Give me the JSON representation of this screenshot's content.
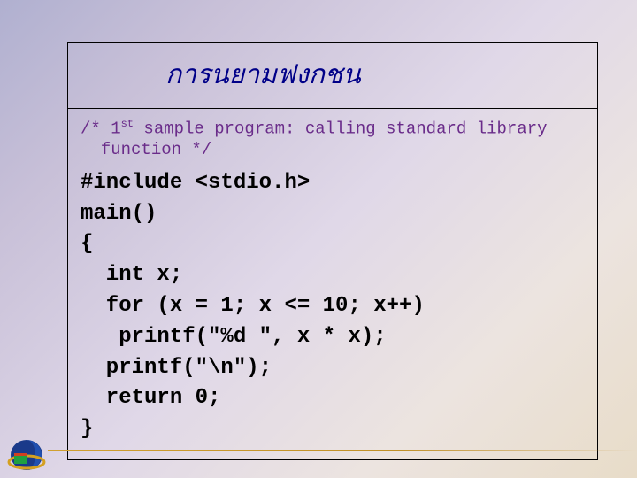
{
  "title": "การนยามฟงกชน",
  "comment_prefix": "/* 1",
  "comment_sup": "st",
  "comment_rest": " sample program: calling standard library\n  function */",
  "code": "#include <stdio.h>\nmain()\n{\n  int x;\n  for (x = 1; x <= 10; x++)\n   printf(\"%d \", x * x);\n  printf(\"\\n\");\n  return 0;\n}"
}
